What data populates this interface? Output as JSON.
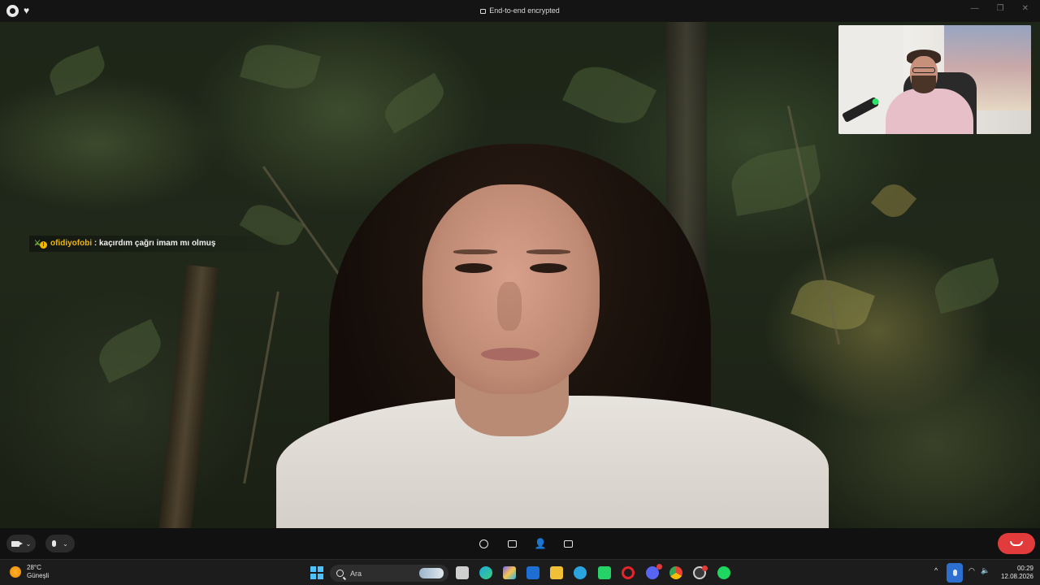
{
  "titlebar": {
    "title": "End-to-end encrypted",
    "app_icon": "whatsapp-icon",
    "pinned_icon": "heart-icon",
    "window_buttons": [
      "—",
      "❐",
      "✕"
    ]
  },
  "chat_overlay": {
    "username": "ofidiyofobi",
    "separator": " : ",
    "message": "kaçırdım çağrı imam mı olmuş",
    "badge_glyph": "!"
  },
  "call_controls": {
    "camera_icon": "video-camera-icon",
    "mic_icon": "microphone-icon",
    "center_icons": [
      "emoji-icon",
      "screen-share-icon",
      "add-participant-icon",
      "more-options-icon"
    ],
    "end_call_icon": "phone-hangup-icon"
  },
  "taskbar": {
    "weather_temp": "28°C",
    "weather_desc": "Güneşli",
    "search_placeholder": "Ara",
    "apps": [
      "file-explorer-icon",
      "edge-icon",
      "copilot-icon",
      "outlook-icon",
      "folder-icon",
      "telegram-icon",
      "whatsapp-icon",
      "opera-icon",
      "discord-icon",
      "chrome-icon",
      "obs-icon",
      "spotify-icon"
    ],
    "tray_caret": "^",
    "time": "00:29",
    "date": "12.08.2026"
  },
  "colors": {
    "accent_end_call": "#e23b3b",
    "chat_username": "#f2b800",
    "windows_blue": "#4cc2ff",
    "mic_active": "#2c6fd1"
  }
}
